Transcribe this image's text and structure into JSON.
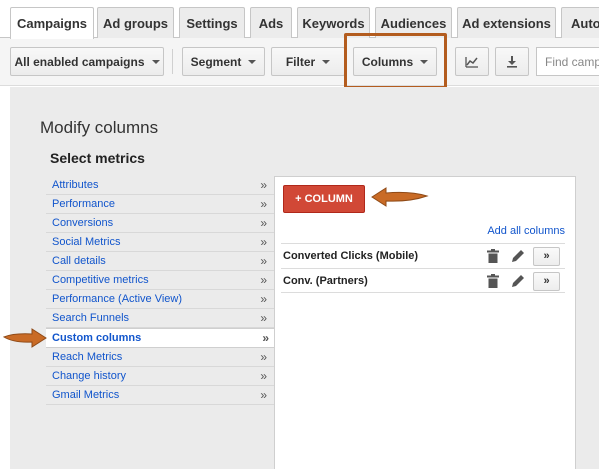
{
  "tabs": [
    {
      "label": "Campaigns",
      "active": true
    },
    {
      "label": "Ad groups",
      "active": false
    },
    {
      "label": "Settings",
      "active": false
    },
    {
      "label": "Ads",
      "active": false
    },
    {
      "label": "Keywords",
      "active": false
    },
    {
      "label": "Audiences",
      "active": false
    },
    {
      "label": "Ad extensions",
      "active": false
    },
    {
      "label": "Auto",
      "active": false
    }
  ],
  "toolbar": {
    "campaign_filter": "All enabled campaigns",
    "segment": "Segment",
    "filter": "Filter",
    "columns": "Columns",
    "search_placeholder": "Find campaigns"
  },
  "modify": {
    "title": "Modify columns",
    "select_metrics": "Select metrics",
    "metrics": [
      {
        "label": "Attributes"
      },
      {
        "label": "Performance"
      },
      {
        "label": "Conversions"
      },
      {
        "label": "Social Metrics"
      },
      {
        "label": "Call details"
      },
      {
        "label": "Competitive metrics"
      },
      {
        "label": "Performance (Active View)"
      },
      {
        "label": "Search Funnels"
      },
      {
        "label": "Custom columns",
        "selected": true
      },
      {
        "label": "Reach Metrics"
      },
      {
        "label": "Change history"
      },
      {
        "label": "Gmail Metrics"
      }
    ],
    "chevron": "»"
  },
  "panel": {
    "add_column_label": "+ COLUMN",
    "add_all_label": "Add all columns",
    "columns": [
      {
        "name": "Converted Clicks (Mobile)",
        "more": "»"
      },
      {
        "name": "Conv. (Partners)",
        "more": "»"
      }
    ]
  },
  "colors": {
    "accent_red": "#d14836",
    "link_blue": "#1155cc",
    "highlight_orange": "#b35c1e"
  }
}
